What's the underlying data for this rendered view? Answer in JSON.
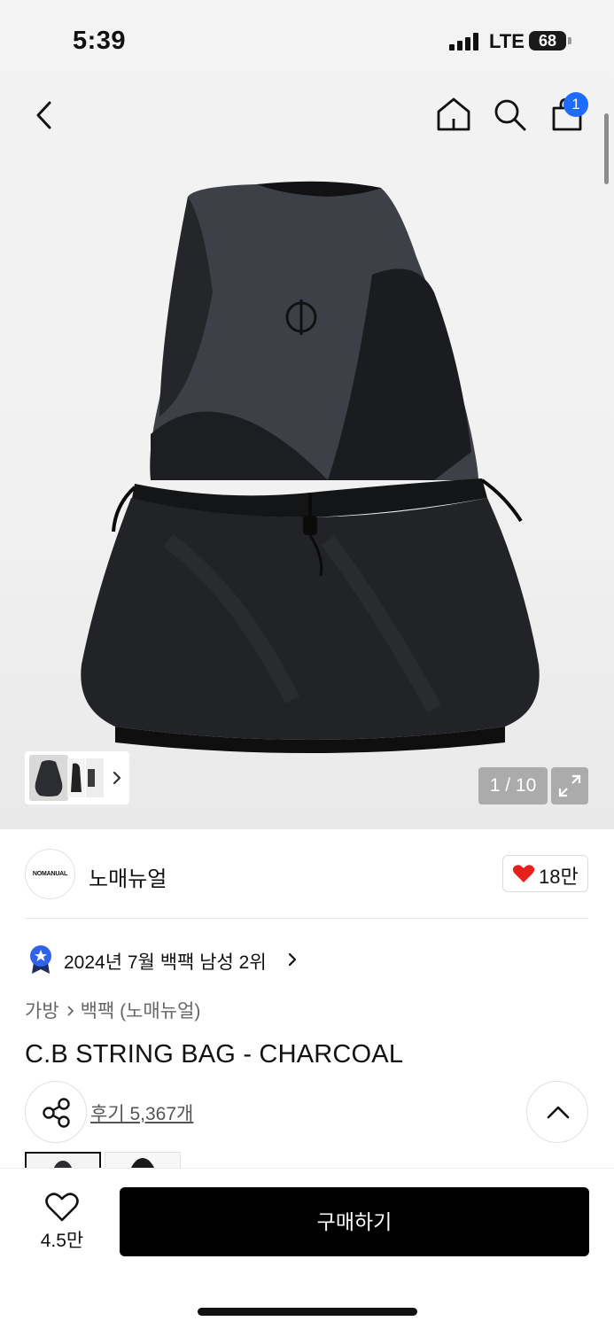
{
  "status_bar": {
    "time": "5:39",
    "network": "LTE",
    "battery": "68"
  },
  "nav": {
    "back_icon": "chevron-left-icon",
    "home_icon": "home-icon",
    "search_icon": "search-icon",
    "cart_icon": "shopping-bag-icon",
    "cart_badge": "1"
  },
  "gallery": {
    "counter": "1 / 10",
    "expand_icon": "expand-icon",
    "thumbnail_count": 3
  },
  "brand": {
    "logo_text": "NOMANUAL",
    "name": "노매뉴얼",
    "likes": "18만"
  },
  "ranking": {
    "text": "2024년 7월 백팩 남성 2위"
  },
  "breadcrumb": {
    "category": "가방",
    "subcategory": "백팩 (노매뉴얼)"
  },
  "product": {
    "title": "C.B STRING BAG - CHARCOAL",
    "reviews": "후기 5,367개"
  },
  "bottom_bar": {
    "wish_count": "4.5만",
    "buy_label": "구매하기"
  },
  "colors": {
    "accent_blue": "#1e6bff",
    "heart_red": "#e8201c",
    "buy_button": "#000000"
  }
}
